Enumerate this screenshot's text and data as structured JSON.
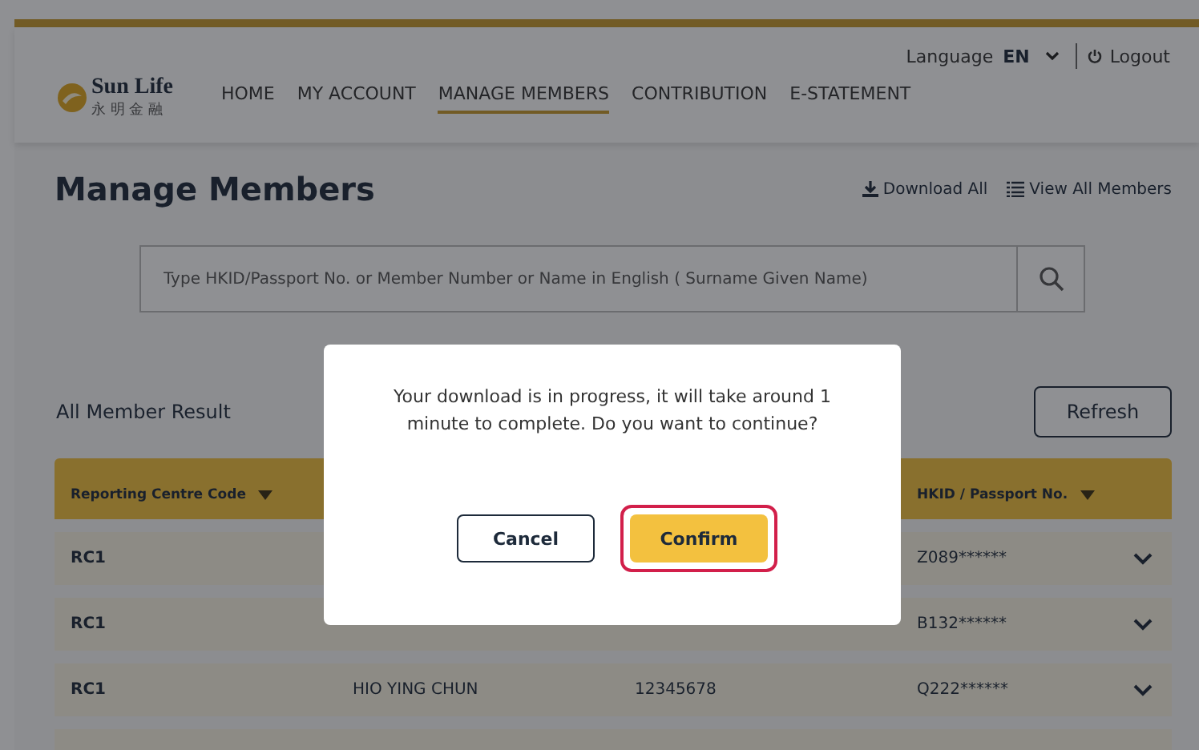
{
  "header": {
    "logo": {
      "name": "Sun Life",
      "subtitle": "永 明 金 融"
    },
    "language": {
      "label": "Language",
      "value": "EN"
    },
    "logout": "Logout",
    "nav": [
      {
        "label": "HOME",
        "selected": false
      },
      {
        "label": "MY ACCOUNT",
        "selected": false
      },
      {
        "label": "MANAGE MEMBERS",
        "selected": true
      },
      {
        "label": "CONTRIBUTION",
        "selected": false
      },
      {
        "label": "E-STATEMENT",
        "selected": false
      }
    ]
  },
  "page": {
    "title": "Manage Members",
    "actions": [
      {
        "kind": "download",
        "label": "Download All"
      },
      {
        "kind": "list",
        "label": "View All Members"
      }
    ],
    "search": {
      "placeholder": "Type HKID/Passport No. or Member Number or Name in English ( Surname Given Name)"
    }
  },
  "results": {
    "title": "All Member Result",
    "refresh": "Refresh",
    "columns": [
      "Reporting Centre Code",
      "",
      "",
      "HKID / Passport No."
    ],
    "rows": [
      {
        "cells": [
          "RC1",
          "",
          "",
          "Z089******"
        ]
      },
      {
        "cells": [
          "RC1",
          "",
          "",
          "B132******"
        ]
      },
      {
        "cells": [
          "RC1",
          "HIO YING CHUN",
          "12345678",
          "Q222******"
        ]
      }
    ]
  },
  "dialog": {
    "message": "Your download is in progress, it will take around 1 minute to complete. Do you want to continue?",
    "buttons": [
      {
        "kind": "secondary",
        "label": "Cancel",
        "highlighted": false
      },
      {
        "kind": "primary",
        "label": "Confirm",
        "highlighted": true
      }
    ]
  }
}
